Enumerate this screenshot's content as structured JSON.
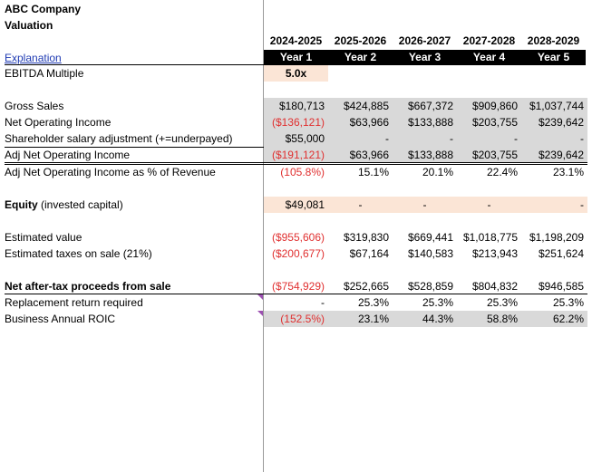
{
  "company": "ABC Company",
  "subtitle": "Valuation",
  "explanation_link": "Explanation",
  "years": [
    "2024-2025",
    "2025-2026",
    "2026-2027",
    "2027-2028",
    "2028-2029"
  ],
  "year_labels": [
    "Year 1",
    "Year 2",
    "Year 3",
    "Year 4",
    "Year 5"
  ],
  "ebitda": {
    "label": "EBITDA Multiple",
    "value": "5.0x"
  },
  "rows": {
    "gross_sales": {
      "label": "Gross Sales",
      "values": [
        "$180,713",
        "$424,885",
        "$667,372",
        "$909,860",
        "$1,037,744"
      ]
    },
    "noi": {
      "label": "Net Operating Income",
      "values": [
        "($136,121)",
        "$63,966",
        "$133,888",
        "$203,755",
        "$239,642"
      ]
    },
    "salary_adj": {
      "label": "Shareholder salary adjustment (+=underpayed)",
      "values": [
        "$55,000",
        "-",
        "-",
        "-",
        "-"
      ]
    },
    "adj_noi": {
      "label": "Adj Net Operating Income",
      "values": [
        "($191,121)",
        "$63,966",
        "$133,888",
        "$203,755",
        "$239,642"
      ]
    },
    "adj_noi_pct": {
      "label": "Adj Net Operating Income as % of Revenue",
      "values": [
        "(105.8%)",
        "15.1%",
        "20.1%",
        "22.4%",
        "23.1%"
      ]
    },
    "equity": {
      "label_bold": "Equity",
      "label_rest": " (invested capital)",
      "values": [
        "$49,081",
        "-",
        "-",
        "-",
        "-"
      ]
    },
    "est_value": {
      "label": "Estimated value",
      "values": [
        "($955,606)",
        "$319,830",
        "$669,441",
        "$1,018,775",
        "$1,198,209"
      ]
    },
    "est_taxes": {
      "label": "Estimated taxes on sale (21%)",
      "values": [
        "($200,677)",
        "$67,164",
        "$140,583",
        "$213,943",
        "$251,624"
      ]
    },
    "net_proceeds": {
      "label": "Net after-tax proceeds from sale",
      "values": [
        "($754,929)",
        "$252,665",
        "$528,859",
        "$804,832",
        "$946,585"
      ]
    },
    "replacement": {
      "label": "Replacement return required",
      "values": [
        "-",
        "25.3%",
        "25.3%",
        "25.3%",
        "25.3%"
      ]
    },
    "roic": {
      "label": "Business Annual ROIC",
      "values": [
        "(152.5%)",
        "23.1%",
        "44.3%",
        "58.8%",
        "62.2%"
      ]
    }
  },
  "colors": {
    "negative": "#e03030",
    "grey_fill": "#d9d9d9",
    "peach_fill": "#fbe5d6",
    "header_bar": "#000000",
    "marker": "#9b4fb0"
  }
}
